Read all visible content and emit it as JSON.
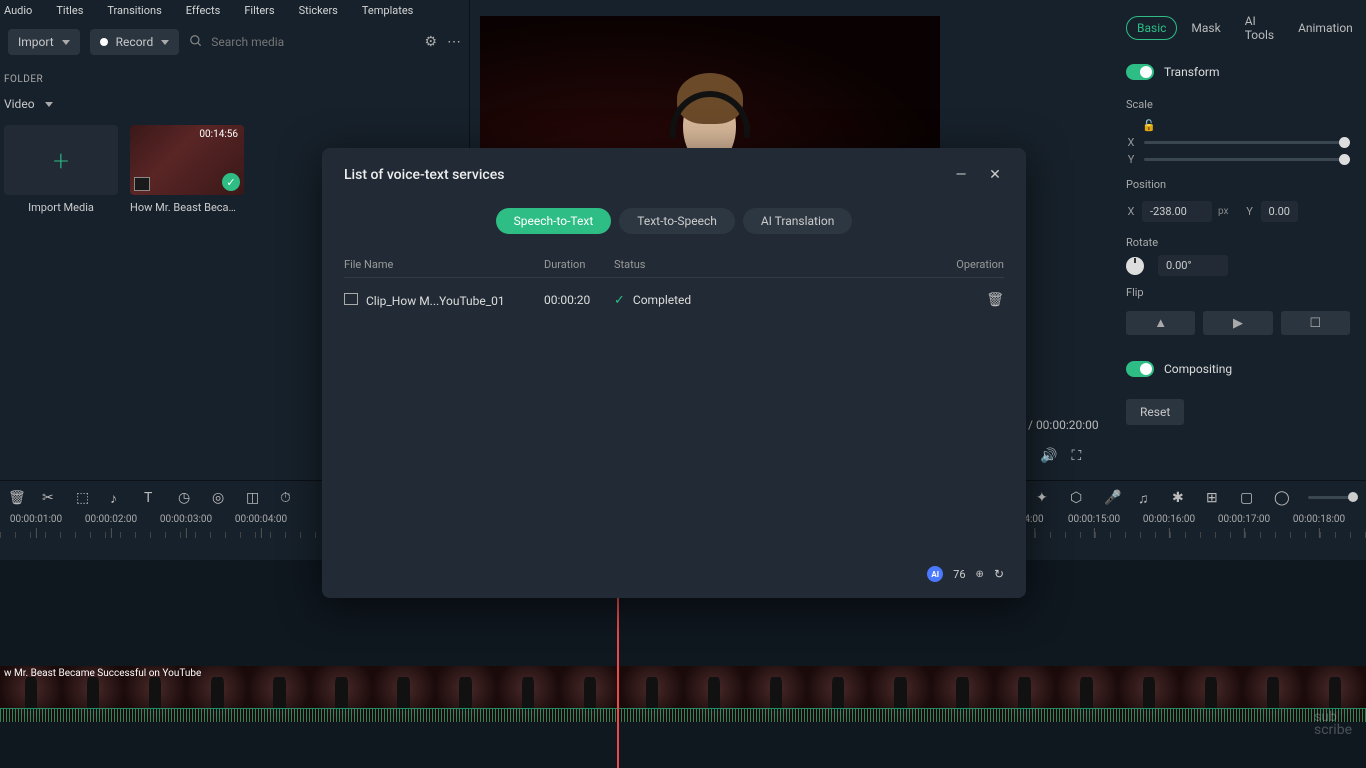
{
  "top_tabs": [
    "Audio",
    "Titles",
    "Transitions",
    "Effects",
    "Filters",
    "Stickers",
    "Templates"
  ],
  "import": {
    "label": "Import",
    "record": "Record"
  },
  "search": {
    "placeholder": "Search media"
  },
  "folder_label": "FOLDER",
  "filter": "Video",
  "media": {
    "import_card": "Import Media",
    "clip": {
      "caption": "How Mr. Beast Becam...",
      "duration": "00:14:56"
    }
  },
  "preview": {
    "total": "00:00:20:00"
  },
  "right": {
    "tabs": [
      "Basic",
      "Mask",
      "AI Tools",
      "Animation"
    ],
    "transform": "Transform",
    "scale": "Scale",
    "x": "X",
    "y": "Y",
    "position": "Position",
    "pos_x": "-238.00",
    "pos_y": "0.00",
    "unit": "px",
    "rotate": "Rotate",
    "rotate_val": "0.00°",
    "flip": "Flip",
    "compositing": "Compositing",
    "reset": "Reset"
  },
  "ruler_left": [
    "00:00:01:00",
    "00:00:02:00",
    "00:00:03:00",
    "00:00:04:00"
  ],
  "ruler_right": [
    "4:00",
    "00:00:15:00",
    "00:00:16:00",
    "00:00:17:00",
    "00:00:18:00"
  ],
  "clip_label": "w Mr. Beast Became Successful on YouTube",
  "modal": {
    "title": "List of voice-text services",
    "tabs": [
      "Speech-to-Text",
      "Text-to-Speech",
      "AI Translation"
    ],
    "cols": {
      "file": "File Name",
      "dur": "Duration",
      "stat": "Status",
      "op": "Operation"
    },
    "row": {
      "file": "Clip_How M...YouTube_01",
      "dur": "00:00:20",
      "status": "Completed"
    },
    "credits": "76"
  },
  "watermark": {
    "l1": "sub",
    "l2": "scribe"
  }
}
